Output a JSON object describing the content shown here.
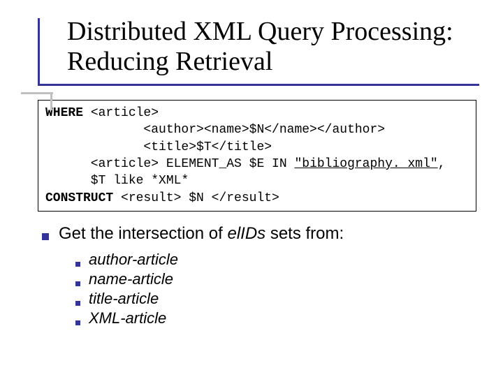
{
  "title": "Distributed XML Query Processing: Reducing Retrieval",
  "code": {
    "l1a": "WHERE",
    "l1b": " <article>",
    "l2": "             <author><name>$N</name></author>",
    "l3": "             <title>$T</title>",
    "l4a": "      <article> ELEMENT_AS $E IN ",
    "l4b": "\"bibliography. xml\"",
    "l4c": ",",
    "l5": "      $T like *XML*",
    "l6a": "CONSTRUCT",
    "l6b": " <result> $N </result>"
  },
  "bullet1": {
    "pre": "Get the intersection of ",
    "em": "elIDs",
    "post": " sets from:"
  },
  "sub_items": [
    "author-article",
    "name-article",
    "title-article",
    "XML-article"
  ]
}
